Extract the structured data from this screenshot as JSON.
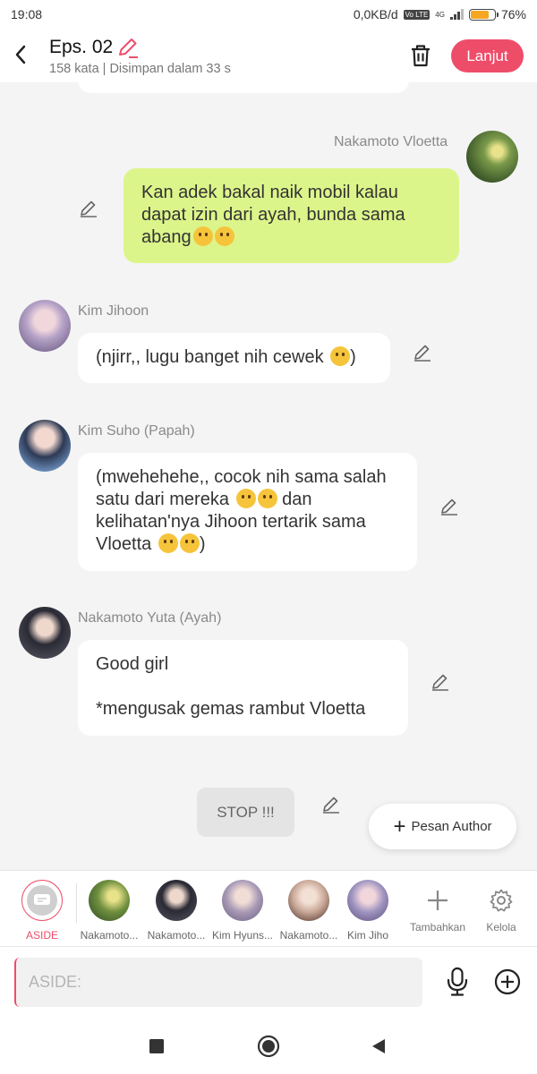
{
  "status": {
    "time": "19:08",
    "net_speed": "0,0KB/d",
    "volte": "Vo LTE",
    "net_type": "4G",
    "battery": "76%",
    "battery_level": 0.76
  },
  "header": {
    "title": "Eps. 02",
    "subtitle": "158 kata | Disimpan dalam 33 s",
    "next_label": "Lanjut"
  },
  "messages": [
    {
      "sender": "Nakamoto Vloetta",
      "side": "right",
      "text": "Kan adek bakal naik mobil kalau dapat izin dari ayah, bunda sama abang",
      "emojis": 2
    },
    {
      "sender": "Kim Jihoon",
      "side": "left",
      "text": "(njirr,, lugu banget nih cewek ",
      "suffix": ")",
      "emojis": 1
    },
    {
      "sender": "Kim Suho (Papah)",
      "side": "left",
      "text": "(mwehehehe,, cocok nih sama salah satu dari mereka ",
      "text2": " dan kelihatan'nya Jihoon tertarik sama Vloetta ",
      "suffix": ")",
      "emojis": 4
    },
    {
      "sender": "Nakamoto Yuta (Ayah)",
      "side": "left",
      "line1": "Good girl",
      "line2": "*mengusak gemas rambut Vloetta"
    }
  ],
  "stop_label": "STOP !!!",
  "pesan_author": {
    "plus": "+",
    "label": "Pesan Author"
  },
  "characters": [
    {
      "label": "ASIDE",
      "color": "#ee4d6a"
    },
    {
      "label": "Nakamoto...",
      "color": "#6f8f3e"
    },
    {
      "label": "Nakamoto...",
      "color": "#2a2a35"
    },
    {
      "label": "Kim Hyuns...",
      "color": "#a89ab5"
    },
    {
      "label": "Nakamoto...",
      "color": "#c9a897"
    },
    {
      "label": "Kim Jiho",
      "color": "#9f93c0"
    }
  ],
  "tools": [
    {
      "label": "Tambahkan",
      "icon": "plus-icon"
    },
    {
      "label": "Kelola",
      "icon": "gear-icon"
    }
  ],
  "input": {
    "placeholder": "ASIDE:"
  }
}
